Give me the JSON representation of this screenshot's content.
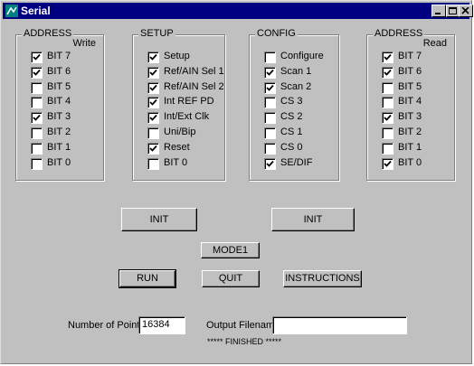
{
  "window": {
    "title": "Serial"
  },
  "groups": {
    "address_write": {
      "title": "ADDRESS",
      "sub": "Write",
      "items": [
        {
          "label": "BIT 7",
          "checked": true
        },
        {
          "label": "BIT 6",
          "checked": true
        },
        {
          "label": "BIT 5",
          "checked": false
        },
        {
          "label": "BIT 4",
          "checked": false
        },
        {
          "label": "BIT 3",
          "checked": true
        },
        {
          "label": "BIT 2",
          "checked": false
        },
        {
          "label": "BIT 1",
          "checked": false
        },
        {
          "label": "BIT 0",
          "checked": false
        }
      ]
    },
    "setup": {
      "title": "SETUP",
      "items": [
        {
          "label": "Setup",
          "checked": true
        },
        {
          "label": "Ref/AIN Sel 1",
          "checked": true
        },
        {
          "label": "Ref/AIN Sel 2",
          "checked": true
        },
        {
          "label": "Int REF PD",
          "checked": true
        },
        {
          "label": "Int/Ext Clk",
          "checked": true
        },
        {
          "label": "Uni/Bip",
          "checked": false
        },
        {
          "label": "Reset",
          "checked": true
        },
        {
          "label": "BIT 0",
          "checked": false
        }
      ]
    },
    "config": {
      "title": "CONFIG",
      "items": [
        {
          "label": "Configure",
          "checked": false
        },
        {
          "label": "Scan 1",
          "checked": true
        },
        {
          "label": "Scan 2",
          "checked": true
        },
        {
          "label": "CS 3",
          "checked": false
        },
        {
          "label": "CS 2",
          "checked": false
        },
        {
          "label": "CS 1",
          "checked": false
        },
        {
          "label": "CS 0",
          "checked": false
        },
        {
          "label": "SE/DIF",
          "checked": true
        }
      ]
    },
    "address_read": {
      "title": "ADDRESS",
      "sub": "Read",
      "items": [
        {
          "label": "BIT 7",
          "checked": true
        },
        {
          "label": "BIT 6",
          "checked": true
        },
        {
          "label": "BIT 5",
          "checked": false
        },
        {
          "label": "BIT 4",
          "checked": false
        },
        {
          "label": "BIT 3",
          "checked": true
        },
        {
          "label": "BIT 2",
          "checked": false
        },
        {
          "label": "BIT 1",
          "checked": false
        },
        {
          "label": "BIT 0",
          "checked": true
        }
      ]
    }
  },
  "buttons": {
    "init_left": "INIT",
    "init_right": "INIT",
    "mode1": "MODE1",
    "run": "RUN",
    "quit": "QUIT",
    "instructions": "INSTRUCTIONS"
  },
  "fields": {
    "points_label": "Number of Points",
    "points_value": "16384",
    "filename_label": "Output Filename",
    "filename_value": ""
  },
  "status": "***** FINISHED *****"
}
